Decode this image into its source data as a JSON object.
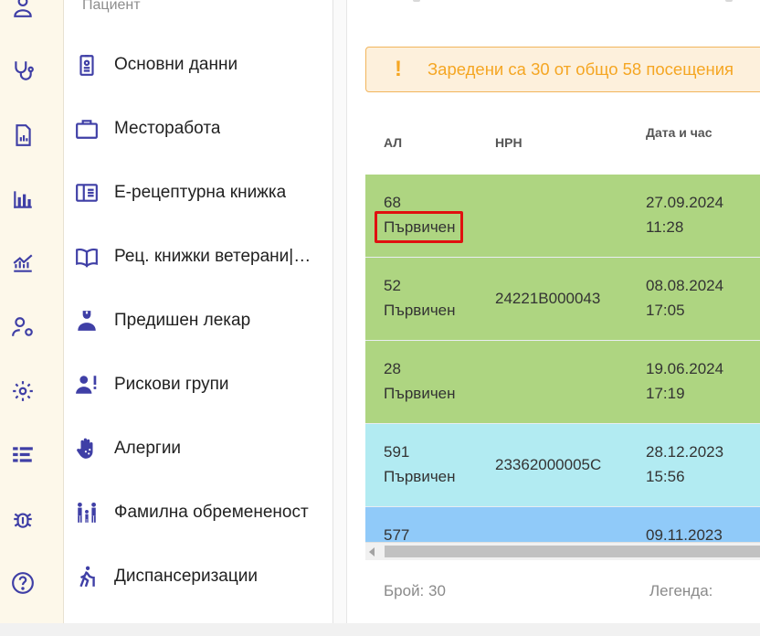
{
  "rail": {
    "icons": [
      "user-icon",
      "stethoscope-icon",
      "report-icon",
      "bar-chart-icon",
      "trend-chart-icon",
      "user-settings-icon",
      "gear-icon",
      "list-icon",
      "bug-icon",
      "help-icon"
    ]
  },
  "menu": {
    "header": "Пациент",
    "items": [
      {
        "label": "Основни данни",
        "icon": "id-badge-icon"
      },
      {
        "label": "Месторабота",
        "icon": "briefcase-icon"
      },
      {
        "label": "Е-рецептурна книжка",
        "icon": "prescription-book-icon"
      },
      {
        "label": "Рец. книжки ветерани|…",
        "icon": "open-book-icon"
      },
      {
        "label": "Предишен лекар",
        "icon": "doctor-icon"
      },
      {
        "label": "Рискови групи",
        "icon": "risk-person-icon"
      },
      {
        "label": "Алергии",
        "icon": "allergy-hand-icon"
      },
      {
        "label": "Фамилна обремененост",
        "icon": "family-icon"
      },
      {
        "label": "Диспансеризации",
        "icon": "walking-person-icon"
      }
    ]
  },
  "alert": {
    "icon": "!",
    "text": "Заредени са 30 от общо 58 посещения"
  },
  "table": {
    "columns": [
      "АЛ",
      "НРН",
      "Дата и час"
    ],
    "rows": [
      {
        "al": "68",
        "type": "Първичен",
        "nrn": "",
        "date": "27.09.2024",
        "time": "11:28",
        "color": "#aed581"
      },
      {
        "al": "52",
        "type": "Първичен",
        "nrn": "24221B000043",
        "date": "08.08.2024",
        "time": "17:05",
        "color": "#aed581"
      },
      {
        "al": "28",
        "type": "Първичен",
        "nrn": "",
        "date": "19.06.2024",
        "time": "17:19",
        "color": "#aed581"
      },
      {
        "al": "591",
        "type": "Първичен",
        "nrn": "23362000005C",
        "date": "28.12.2023",
        "time": "15:56",
        "color": "#b2ebf2"
      },
      {
        "al": "577",
        "type": "",
        "nrn": "",
        "date": "09.11.2023",
        "time": "",
        "color": "#90caf9"
      }
    ]
  },
  "footer": {
    "count": "Брой: 30",
    "legend": "Легенда:"
  }
}
